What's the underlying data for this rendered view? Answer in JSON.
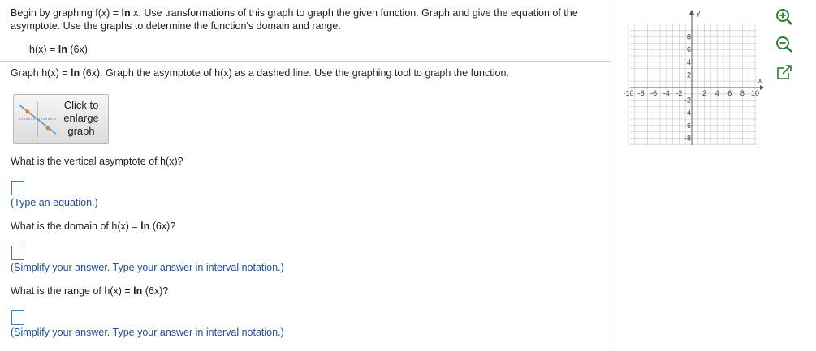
{
  "intro": {
    "part1": "Begin by graphing f(x) = ",
    "ln_bold": "ln",
    "part2": " x. Use transformations of this graph to graph the given function. Graph and give the equation of the asymptote. Use the graphs to determine the function's domain and range."
  },
  "function_line": {
    "prefix": "h(x) = ",
    "ln_bold": "ln",
    "arg": " (6x)"
  },
  "graph_instruction": {
    "part1": "Graph h(x) = ",
    "ln_bold": "ln",
    "part2": " (6x). Graph the asymptote of h(x) as a dashed line. Use the graphing tool to graph the function."
  },
  "enlarge_button": {
    "line1": "Click to",
    "line2": "enlarge",
    "line3": "graph"
  },
  "questions": {
    "q1": {
      "text": "What is the vertical asymptote of h(x)?",
      "hint": "(Type an equation.)",
      "value": ""
    },
    "q2": {
      "prefix": "What is the domain of h(x) = ",
      "ln_bold": "ln",
      "suffix": " (6x)?",
      "hint": "(Simplify your answer. Type your answer in interval notation.)",
      "value": ""
    },
    "q3": {
      "prefix": "What is the range of h(x) = ",
      "ln_bold": "ln",
      "suffix": " (6x)?",
      "hint": "(Simplify your answer. Type your answer in interval notation.)",
      "value": ""
    }
  },
  "graph": {
    "x_label": "x",
    "y_label": "y",
    "x_ticks": [
      "-10",
      "-8",
      "-6",
      "-4",
      "-2",
      "2",
      "4",
      "6",
      "8",
      "10"
    ],
    "y_ticks": [
      "8",
      "6",
      "4",
      "2",
      "-2",
      "-4",
      "-6",
      "-8"
    ]
  },
  "tools": {
    "zoom_in": "zoom-in-icon",
    "zoom_out": "zoom-out-icon",
    "popout": "popout-icon"
  },
  "colors": {
    "hint_text": "#1f4fa0",
    "answer_box_border": "#4a76c9",
    "tool_icon": "#2e7d32"
  }
}
